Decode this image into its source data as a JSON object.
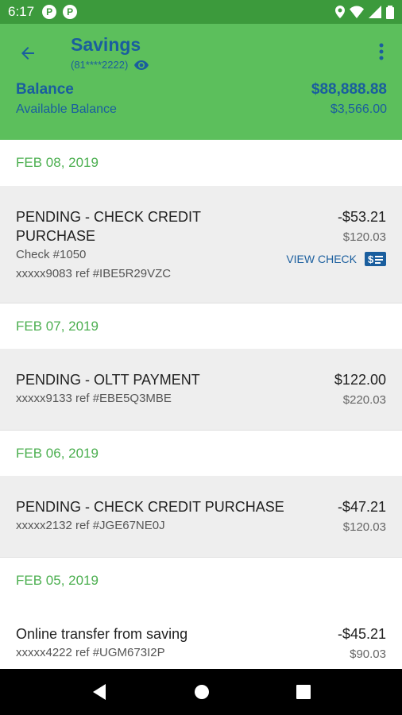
{
  "status_bar": {
    "time": "6:17",
    "notif1": "P",
    "notif2": "P"
  },
  "header": {
    "title": "Savings",
    "account_number": "(81****2222)",
    "balance_label": "Balance",
    "balance_value": "$88,888.88",
    "available_label": "Available Balance",
    "available_value": "$3,566.00"
  },
  "transactions": [
    {
      "date": "FEB 08, 2019",
      "description_line1": "PENDING - CHECK CREDIT",
      "description_line2": "PURCHASE",
      "check": "Check #1050",
      "ref": "xxxxx9083 ref #IBE5R29VZC",
      "amount": "-$53.21",
      "balance": "$120.03",
      "view_check": "VIEW CHECK"
    },
    {
      "date": "FEB 07, 2019",
      "description": "PENDING - OLTT PAYMENT",
      "ref": "xxxxx9133 ref #EBE5Q3MBE",
      "amount": "$122.00",
      "balance": "$220.03"
    },
    {
      "date": "FEB 06, 2019",
      "description": "PENDING - CHECK CREDIT PURCHASE",
      "ref": "xxxxx2132 ref #JGE67NE0J",
      "amount": "-$47.21",
      "balance": "$120.03"
    },
    {
      "date": "FEB 05, 2019",
      "description": "Online transfer from saving",
      "ref": "xxxxx4222 ref #UGM673I2P",
      "amount": "-$45.21",
      "balance": "$90.03"
    }
  ],
  "colors": {
    "status_bar": "#3c9a3c",
    "header": "#5cbf5c",
    "accent_blue": "#1a5e9e",
    "date_green": "#4caf50"
  },
  "icons": {
    "back": "arrow-left-icon",
    "visibility": "eye-icon",
    "menu": "more-vert-icon",
    "check": "check-icon"
  }
}
